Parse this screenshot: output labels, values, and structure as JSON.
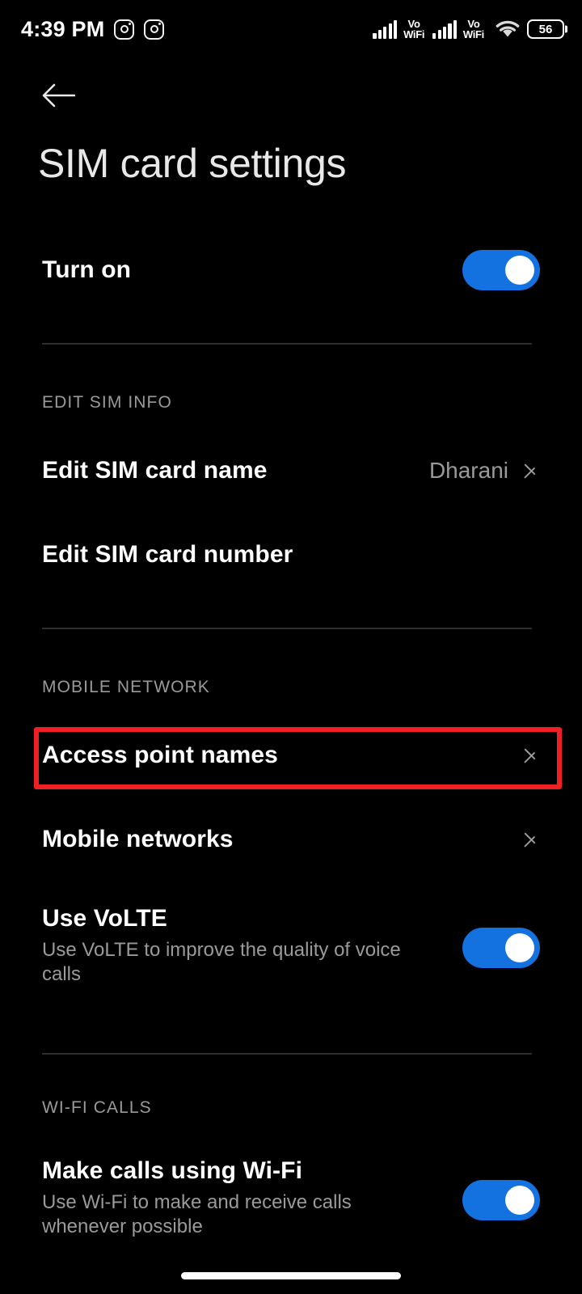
{
  "status_bar": {
    "time": "4:39 PM",
    "notification_icons": [
      "instagram-icon",
      "instagram-icon"
    ],
    "signal_1": "cellular-signal-icon",
    "volte_1_line1": "Vo",
    "volte_1_line2": "WiFi",
    "signal_2": "cellular-signal-icon",
    "volte_2_line1": "Vo",
    "volte_2_line2": "WiFi",
    "wifi": "wifi-icon",
    "battery_percent": "56"
  },
  "header": {
    "back_icon": "arrow-left-icon",
    "title": "SIM card settings"
  },
  "colors": {
    "background": "#000000",
    "toggle_on": "#1471e0",
    "highlight_border": "#ee2024",
    "primary_text": "#ffffff",
    "secondary_text": "#9a9a9a",
    "divider": "#2c2c2c"
  },
  "rows": {
    "turn_on": {
      "title": "Turn on",
      "toggle_state": "on"
    },
    "edit_sim_name": {
      "title": "Edit SIM card name",
      "value": "Dharani",
      "chevron": "chevron-right-icon"
    },
    "edit_sim_number": {
      "title": "Edit SIM card number"
    },
    "apn": {
      "title": "Access point names",
      "chevron": "chevron-right-icon",
      "highlighted": "true"
    },
    "mobile_networks": {
      "title": "Mobile networks",
      "chevron": "chevron-right-icon"
    },
    "use_volte": {
      "title": "Use VoLTE",
      "subtitle": "Use VoLTE to improve the quality of voice calls",
      "toggle_state": "on"
    },
    "wifi_calls": {
      "title": "Make calls using Wi-Fi",
      "subtitle": "Use Wi-Fi to make and receive calls whenever possible",
      "toggle_state": "on"
    }
  },
  "sections": {
    "edit_sim_info": "EDIT SIM INFO",
    "mobile_network": "MOBILE NETWORK",
    "wifi_calls": "WI-FI CALLS"
  }
}
